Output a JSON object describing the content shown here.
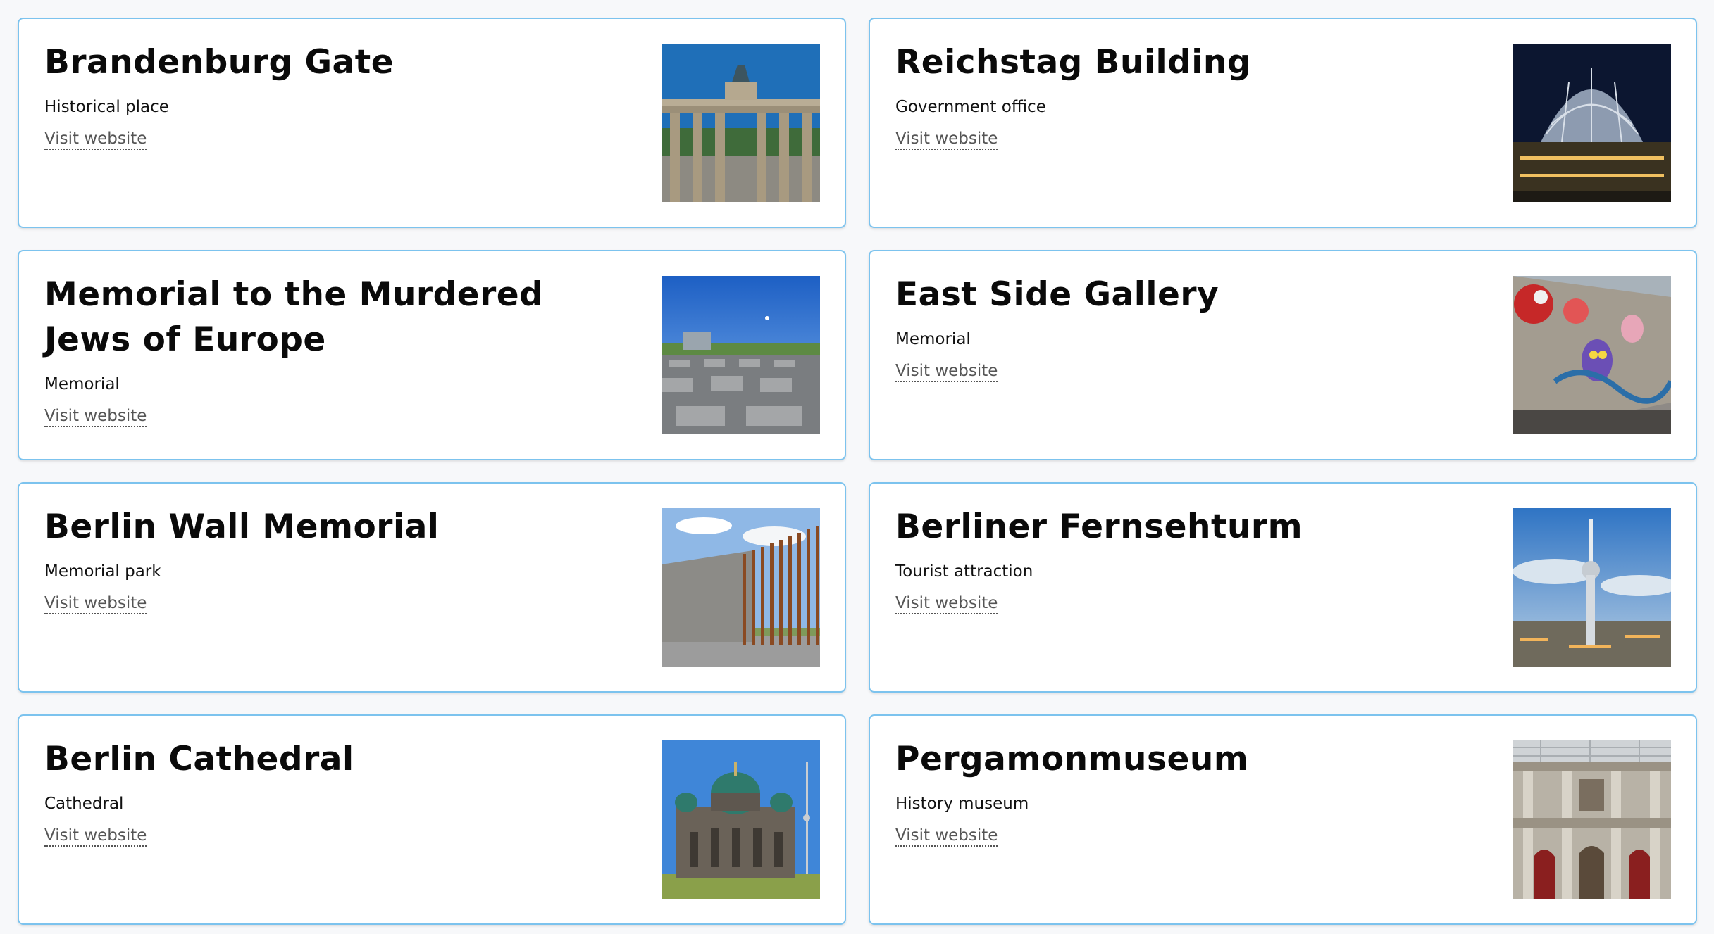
{
  "link_label": "Visit website",
  "places": [
    {
      "title": "Brandenburg Gate",
      "category": "Historical place",
      "link": "Visit website",
      "image": "brandenburg-gate-photo"
    },
    {
      "title": "Reichstag Building",
      "category": "Government office",
      "link": "Visit website",
      "image": "reichstag-dome-photo"
    },
    {
      "title": "Memorial to the Murdered Jews of Europe",
      "category": "Memorial",
      "link": "Visit website",
      "image": "holocaust-memorial-photo"
    },
    {
      "title": "East Side Gallery",
      "category": "Memorial",
      "link": "Visit website",
      "image": "east-side-gallery-photo"
    },
    {
      "title": "Berlin Wall Memorial",
      "category": "Memorial park",
      "link": "Visit website",
      "image": "berlin-wall-memorial-photo"
    },
    {
      "title": "Berliner Fernsehturm",
      "category": "Tourist attraction",
      "link": "Visit website",
      "image": "tv-tower-photo"
    },
    {
      "title": "Berlin Cathedral",
      "category": "Cathedral",
      "link": "Visit website",
      "image": "berlin-cathedral-photo"
    },
    {
      "title": "Pergamonmuseum",
      "category": "History museum",
      "link": "Visit website",
      "image": "pergamon-museum-photo"
    }
  ],
  "colors": {
    "card_border": "#7cc3ee",
    "page_background": "#f7f8fa",
    "link": "#555555"
  }
}
